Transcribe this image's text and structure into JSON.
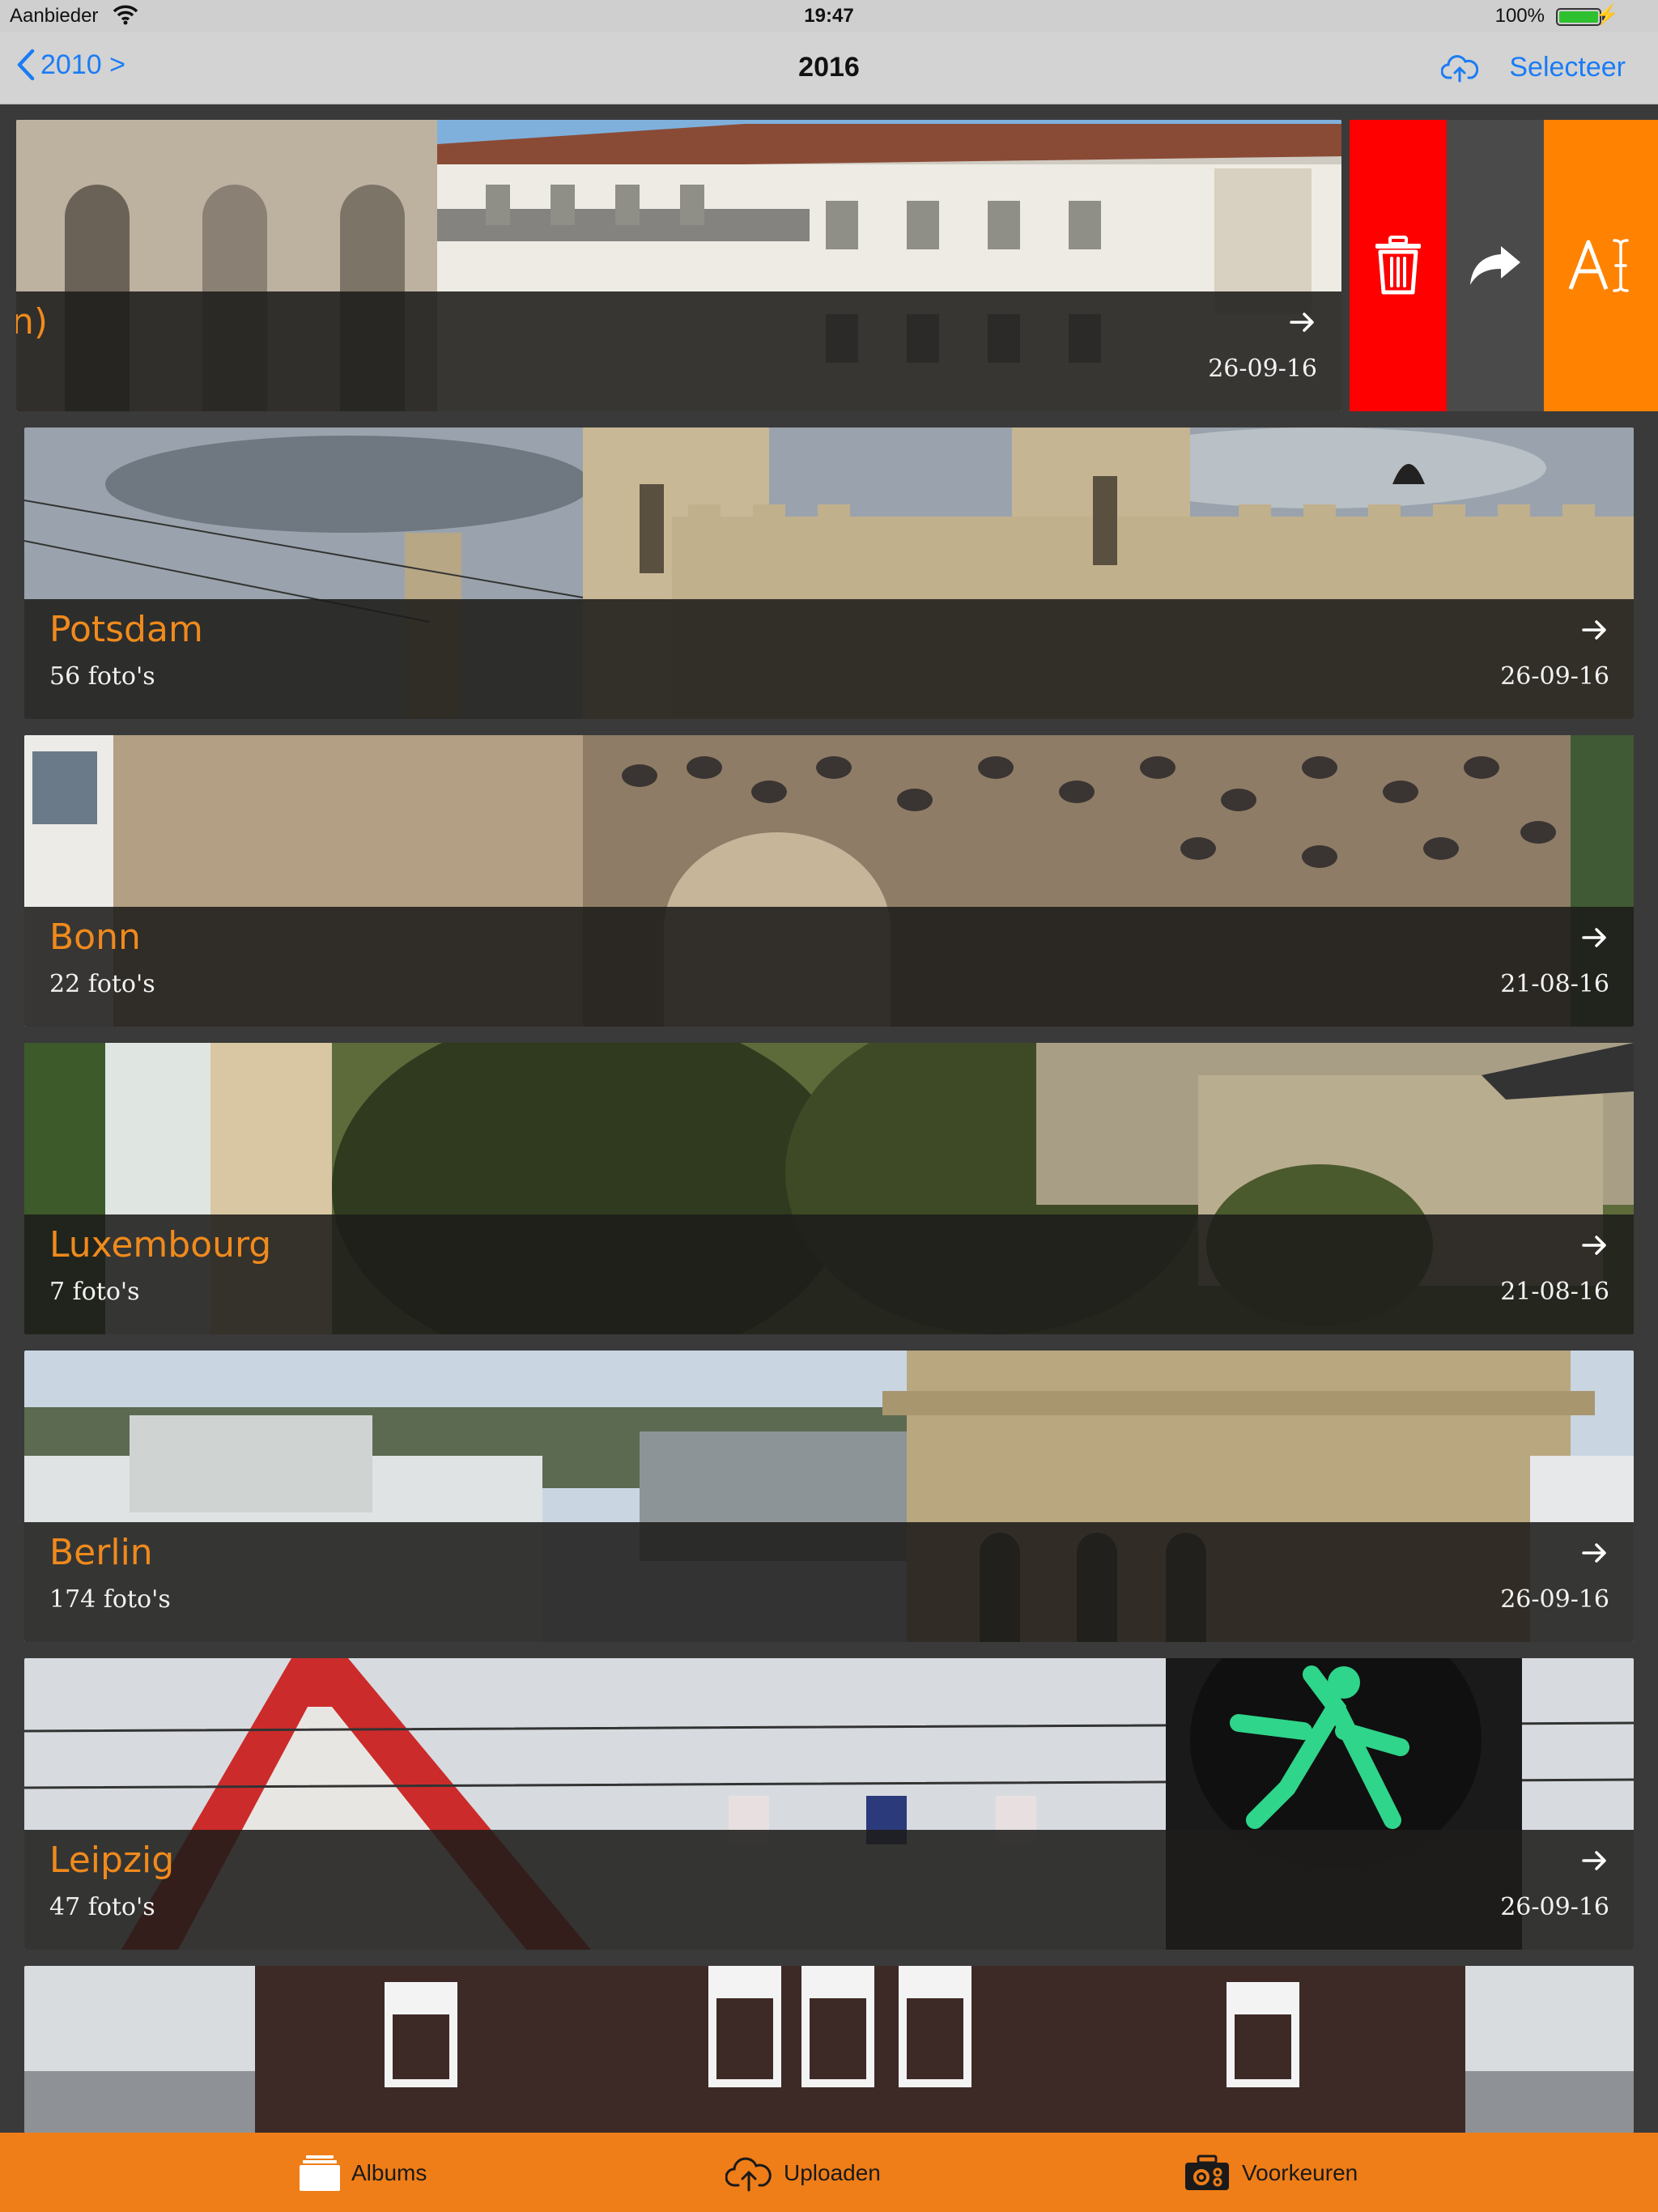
{
  "status_bar": {
    "carrier": "Aanbieder",
    "time": "19:47",
    "battery": "100%"
  },
  "nav": {
    "back_label": "2010 >",
    "title": "2016",
    "select_label": "Selecteer"
  },
  "albums": [
    {
      "name": "n)",
      "count": "",
      "date": "26-09-16",
      "swiped": true
    },
    {
      "name": "Potsdam",
      "count": "56 foto's",
      "date": "26-09-16"
    },
    {
      "name": "Bonn",
      "count": "22 foto's",
      "date": "21-08-16"
    },
    {
      "name": "Luxembourg",
      "count": "7 foto's",
      "date": "21-08-16"
    },
    {
      "name": "Berlin",
      "count": "174 foto's",
      "date": "26-09-16"
    },
    {
      "name": "Leipzig",
      "count": "47 foto's",
      "date": "26-09-16"
    }
  ],
  "swipe_actions": {
    "delete_icon": "trash-icon",
    "share_icon": "share-arrow-icon",
    "rename_icon": "rename-text-icon",
    "colors": {
      "delete": "#ff0000",
      "share": "#4a4a4a",
      "rename": "#ff8200"
    }
  },
  "tabs": {
    "albums": "Albums",
    "upload": "Uploaden",
    "preferences": "Voorkeuren"
  },
  "colors": {
    "accent": "#f08a1c",
    "link": "#1a7cf5",
    "tabbar": "#ef7d18"
  }
}
